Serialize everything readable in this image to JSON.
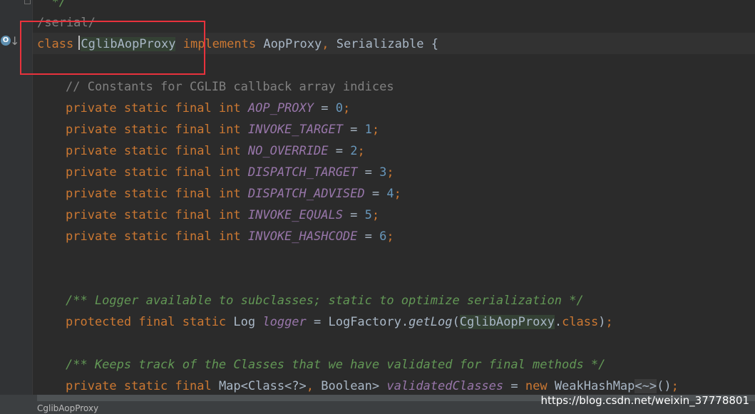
{
  "editor": {
    "lines": [
      {
        "id": "top-comment-line",
        "tokens": [
          {
            "t": "  */",
            "c": "doc"
          }
        ]
      },
      {
        "id": "annotation-line",
        "tokens": [
          {
            "t": "/serial/",
            "c": "cmt"
          }
        ]
      },
      {
        "id": "class-declaration-line",
        "tokens": [
          {
            "t": "class ",
            "c": "kw"
          },
          {
            "t": "CglibAopProxy",
            "c": "hl"
          },
          {
            "t": " ",
            "c": "id"
          },
          {
            "t": "implements",
            "c": "kw"
          },
          {
            "t": " AopProxy",
            "c": "id"
          },
          {
            "t": ", ",
            "c": "kw"
          },
          {
            "t": "Serializable {",
            "c": "id"
          }
        ]
      },
      {
        "id": "constants-comment-line",
        "tokens": [
          {
            "t": "// Constants for CGLIB callback array indices",
            "c": "cmt"
          }
        ]
      },
      {
        "id": "const-aop-proxy-line",
        "tokens": [
          {
            "t": "private static final int ",
            "c": "kw"
          },
          {
            "t": "AOP_PROXY",
            "c": "cst"
          },
          {
            "t": " = ",
            "c": "id"
          },
          {
            "t": "0",
            "c": "num"
          },
          {
            "t": ";",
            "c": "kw"
          }
        ]
      },
      {
        "id": "const-invoke-target-line",
        "tokens": [
          {
            "t": "private static final int ",
            "c": "kw"
          },
          {
            "t": "INVOKE_TARGET",
            "c": "cst"
          },
          {
            "t": " = ",
            "c": "id"
          },
          {
            "t": "1",
            "c": "num"
          },
          {
            "t": ";",
            "c": "kw"
          }
        ]
      },
      {
        "id": "const-no-override-line",
        "tokens": [
          {
            "t": "private static final int ",
            "c": "kw"
          },
          {
            "t": "NO_OVERRIDE",
            "c": "cst"
          },
          {
            "t": " = ",
            "c": "id"
          },
          {
            "t": "2",
            "c": "num"
          },
          {
            "t": ";",
            "c": "kw"
          }
        ]
      },
      {
        "id": "const-dispatch-target-line",
        "tokens": [
          {
            "t": "private static final int ",
            "c": "kw"
          },
          {
            "t": "DISPATCH_TARGET",
            "c": "cst"
          },
          {
            "t": " = ",
            "c": "id"
          },
          {
            "t": "3",
            "c": "num"
          },
          {
            "t": ";",
            "c": "kw"
          }
        ]
      },
      {
        "id": "const-dispatch-advised-line",
        "tokens": [
          {
            "t": "private static final int ",
            "c": "kw"
          },
          {
            "t": "DISPATCH_ADVISED",
            "c": "cst"
          },
          {
            "t": " = ",
            "c": "id"
          },
          {
            "t": "4",
            "c": "num"
          },
          {
            "t": ";",
            "c": "kw"
          }
        ]
      },
      {
        "id": "const-invoke-equals-line",
        "tokens": [
          {
            "t": "private static final int ",
            "c": "kw"
          },
          {
            "t": "INVOKE_EQUALS",
            "c": "cst"
          },
          {
            "t": " = ",
            "c": "id"
          },
          {
            "t": "5",
            "c": "num"
          },
          {
            "t": ";",
            "c": "kw"
          }
        ]
      },
      {
        "id": "const-invoke-hashcode-line",
        "tokens": [
          {
            "t": "private static final int ",
            "c": "kw"
          },
          {
            "t": "INVOKE_HASHCODE",
            "c": "cst"
          },
          {
            "t": " = ",
            "c": "id"
          },
          {
            "t": "6",
            "c": "num"
          },
          {
            "t": ";",
            "c": "kw"
          }
        ]
      },
      {
        "id": "logger-doc-comment-line",
        "tokens": [
          {
            "t": "/** Logger available to subclasses; static to optimize serialization */",
            "c": "doc"
          }
        ]
      },
      {
        "id": "logger-field-line",
        "tokens": [
          {
            "t": "protected final static ",
            "c": "kw"
          },
          {
            "t": "Log ",
            "c": "id"
          },
          {
            "t": "logger",
            "c": "fld"
          },
          {
            "t": " = LogFactory.",
            "c": "id"
          },
          {
            "t": "getLog",
            "c": "fn"
          },
          {
            "t": "(",
            "c": "id"
          },
          {
            "t": "CglibAopProxy",
            "c": "hl"
          },
          {
            "t": ".",
            "c": "id"
          },
          {
            "t": "class",
            "c": "kw"
          },
          {
            "t": ")",
            "c": "id"
          },
          {
            "t": ";",
            "c": "kw"
          }
        ]
      },
      {
        "id": "validated-doc-comment-line",
        "tokens": [
          {
            "t": "/** Keeps track of the Classes that we have validated for final methods */",
            "c": "doc"
          }
        ]
      },
      {
        "id": "validated-classes-field-line",
        "tokens": [
          {
            "t": "private static final ",
            "c": "kw"
          },
          {
            "t": "Map<Class<?>",
            "c": "id"
          },
          {
            "t": ", ",
            "c": "kw"
          },
          {
            "t": "Boolean> ",
            "c": "id"
          },
          {
            "t": "validatedClasses",
            "c": "fld"
          },
          {
            "t": " = ",
            "c": "id"
          },
          {
            "t": "new ",
            "c": "kw"
          },
          {
            "t": "WeakHashMap",
            "c": "id"
          },
          {
            "t": "<~>",
            "c": "fold"
          },
          {
            "t": "()",
            "c": "id"
          },
          {
            "t": ";",
            "c": "kw"
          }
        ]
      }
    ]
  },
  "status_bar": {
    "breadcrumb": "CglibAopProxy"
  },
  "watermark": "https://blog.csdn.net/weixin_37778801"
}
